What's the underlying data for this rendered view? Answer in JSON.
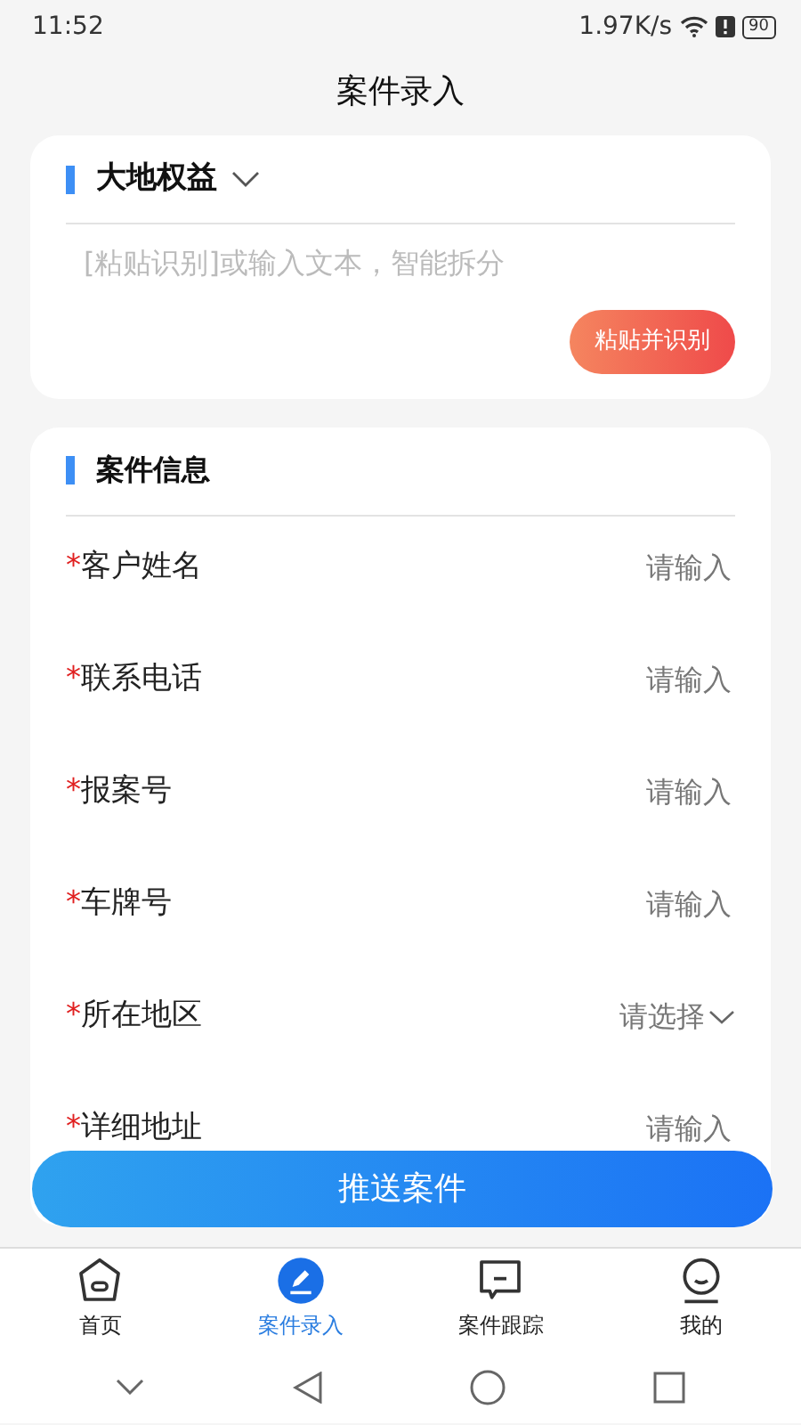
{
  "status_bar": {
    "time": "11:52",
    "speed": "1.97K/s",
    "battery": "90"
  },
  "header": {
    "title": "案件录入"
  },
  "company": {
    "name": "大地权益",
    "placeholder": "[粘贴识别]或输入文本，智能拆分",
    "button": "粘贴并识别"
  },
  "section": {
    "title": "案件信息",
    "fields": [
      {
        "label": "客户姓名",
        "mark": "*",
        "kind": "input",
        "placeholder": "请输入"
      },
      {
        "label": "联系电话",
        "mark": "*",
        "kind": "input",
        "placeholder": "请输入"
      },
      {
        "label": "报案号",
        "mark": "*",
        "kind": "input",
        "placeholder": "请输入"
      },
      {
        "label": "车牌号",
        "mark": "*",
        "kind": "input",
        "placeholder": "请输入"
      },
      {
        "label": "所在地区",
        "mark": "*",
        "kind": "select",
        "placeholder": "请选择"
      },
      {
        "label": "详细地址",
        "mark": "*",
        "kind": "input",
        "placeholder": "请输入"
      }
    ]
  },
  "submit": "推送案件",
  "tabs": [
    {
      "label": "首页",
      "selected": false
    },
    {
      "label": "案件录入",
      "selected": true
    },
    {
      "label": "案件跟踪",
      "selected": false
    },
    {
      "label": "我的",
      "selected": false
    }
  ]
}
